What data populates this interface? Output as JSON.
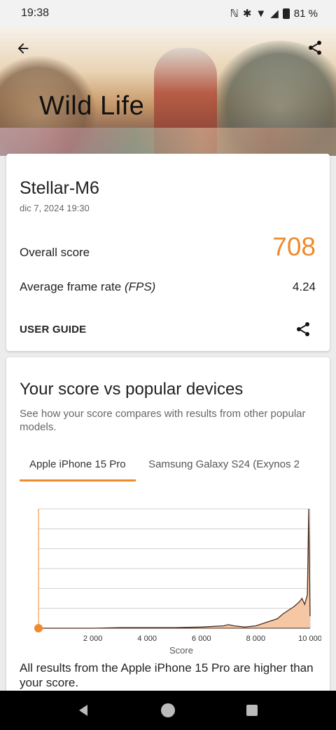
{
  "status_bar": {
    "time": "19:38",
    "battery": "81 %"
  },
  "header": {
    "title": "Wild Life"
  },
  "result": {
    "device": "Stellar-M6",
    "date": "dic 7, 2024 19:30",
    "overall_label": "Overall score",
    "overall_value": "708",
    "fps_label": "Average frame rate",
    "fps_unit": "(FPS)",
    "fps_value": "4.24",
    "guide_label": "USER GUIDE"
  },
  "compare": {
    "title": "Your score vs popular devices",
    "description": "See how your score compares with results from other popular models.",
    "tabs": [
      {
        "label": "Apple iPhone 15 Pro",
        "active": true
      },
      {
        "label": "Samsung Galaxy S24 (Exynos 2",
        "active": false
      }
    ],
    "footnote": "All results from the Apple iPhone 15 Pro are higher than your score."
  },
  "colors": {
    "accent": "#f08a2c",
    "fill": "#f6c7a4",
    "line": "#4a2f22"
  },
  "icons": {
    "back": "arrow-left-icon",
    "share": "share-icon"
  },
  "chart_data": {
    "type": "area",
    "xlabel": "Score",
    "ylabel": "",
    "xlim": [
      0,
      10000
    ],
    "x_ticks": [
      "2 000",
      "4 000",
      "6 000",
      "8 000",
      "10 000"
    ],
    "x_tick_values": [
      2000,
      4000,
      6000,
      8000,
      10000
    ],
    "your_score": 708,
    "distribution": {
      "x": [
        0,
        2000,
        3000,
        4000,
        5000,
        6000,
        6800,
        7000,
        7200,
        7600,
        8000,
        8400,
        8800,
        9000,
        9200,
        9400,
        9600,
        9700,
        9800,
        9900,
        9950,
        10000
      ],
      "y": [
        0,
        0,
        0.005,
        0.005,
        0.005,
        0.01,
        0.02,
        0.03,
        0.02,
        0.01,
        0.02,
        0.05,
        0.08,
        0.12,
        0.15,
        0.18,
        0.22,
        0.25,
        0.2,
        0.28,
        1.0,
        0.1
      ]
    },
    "grid": true
  }
}
